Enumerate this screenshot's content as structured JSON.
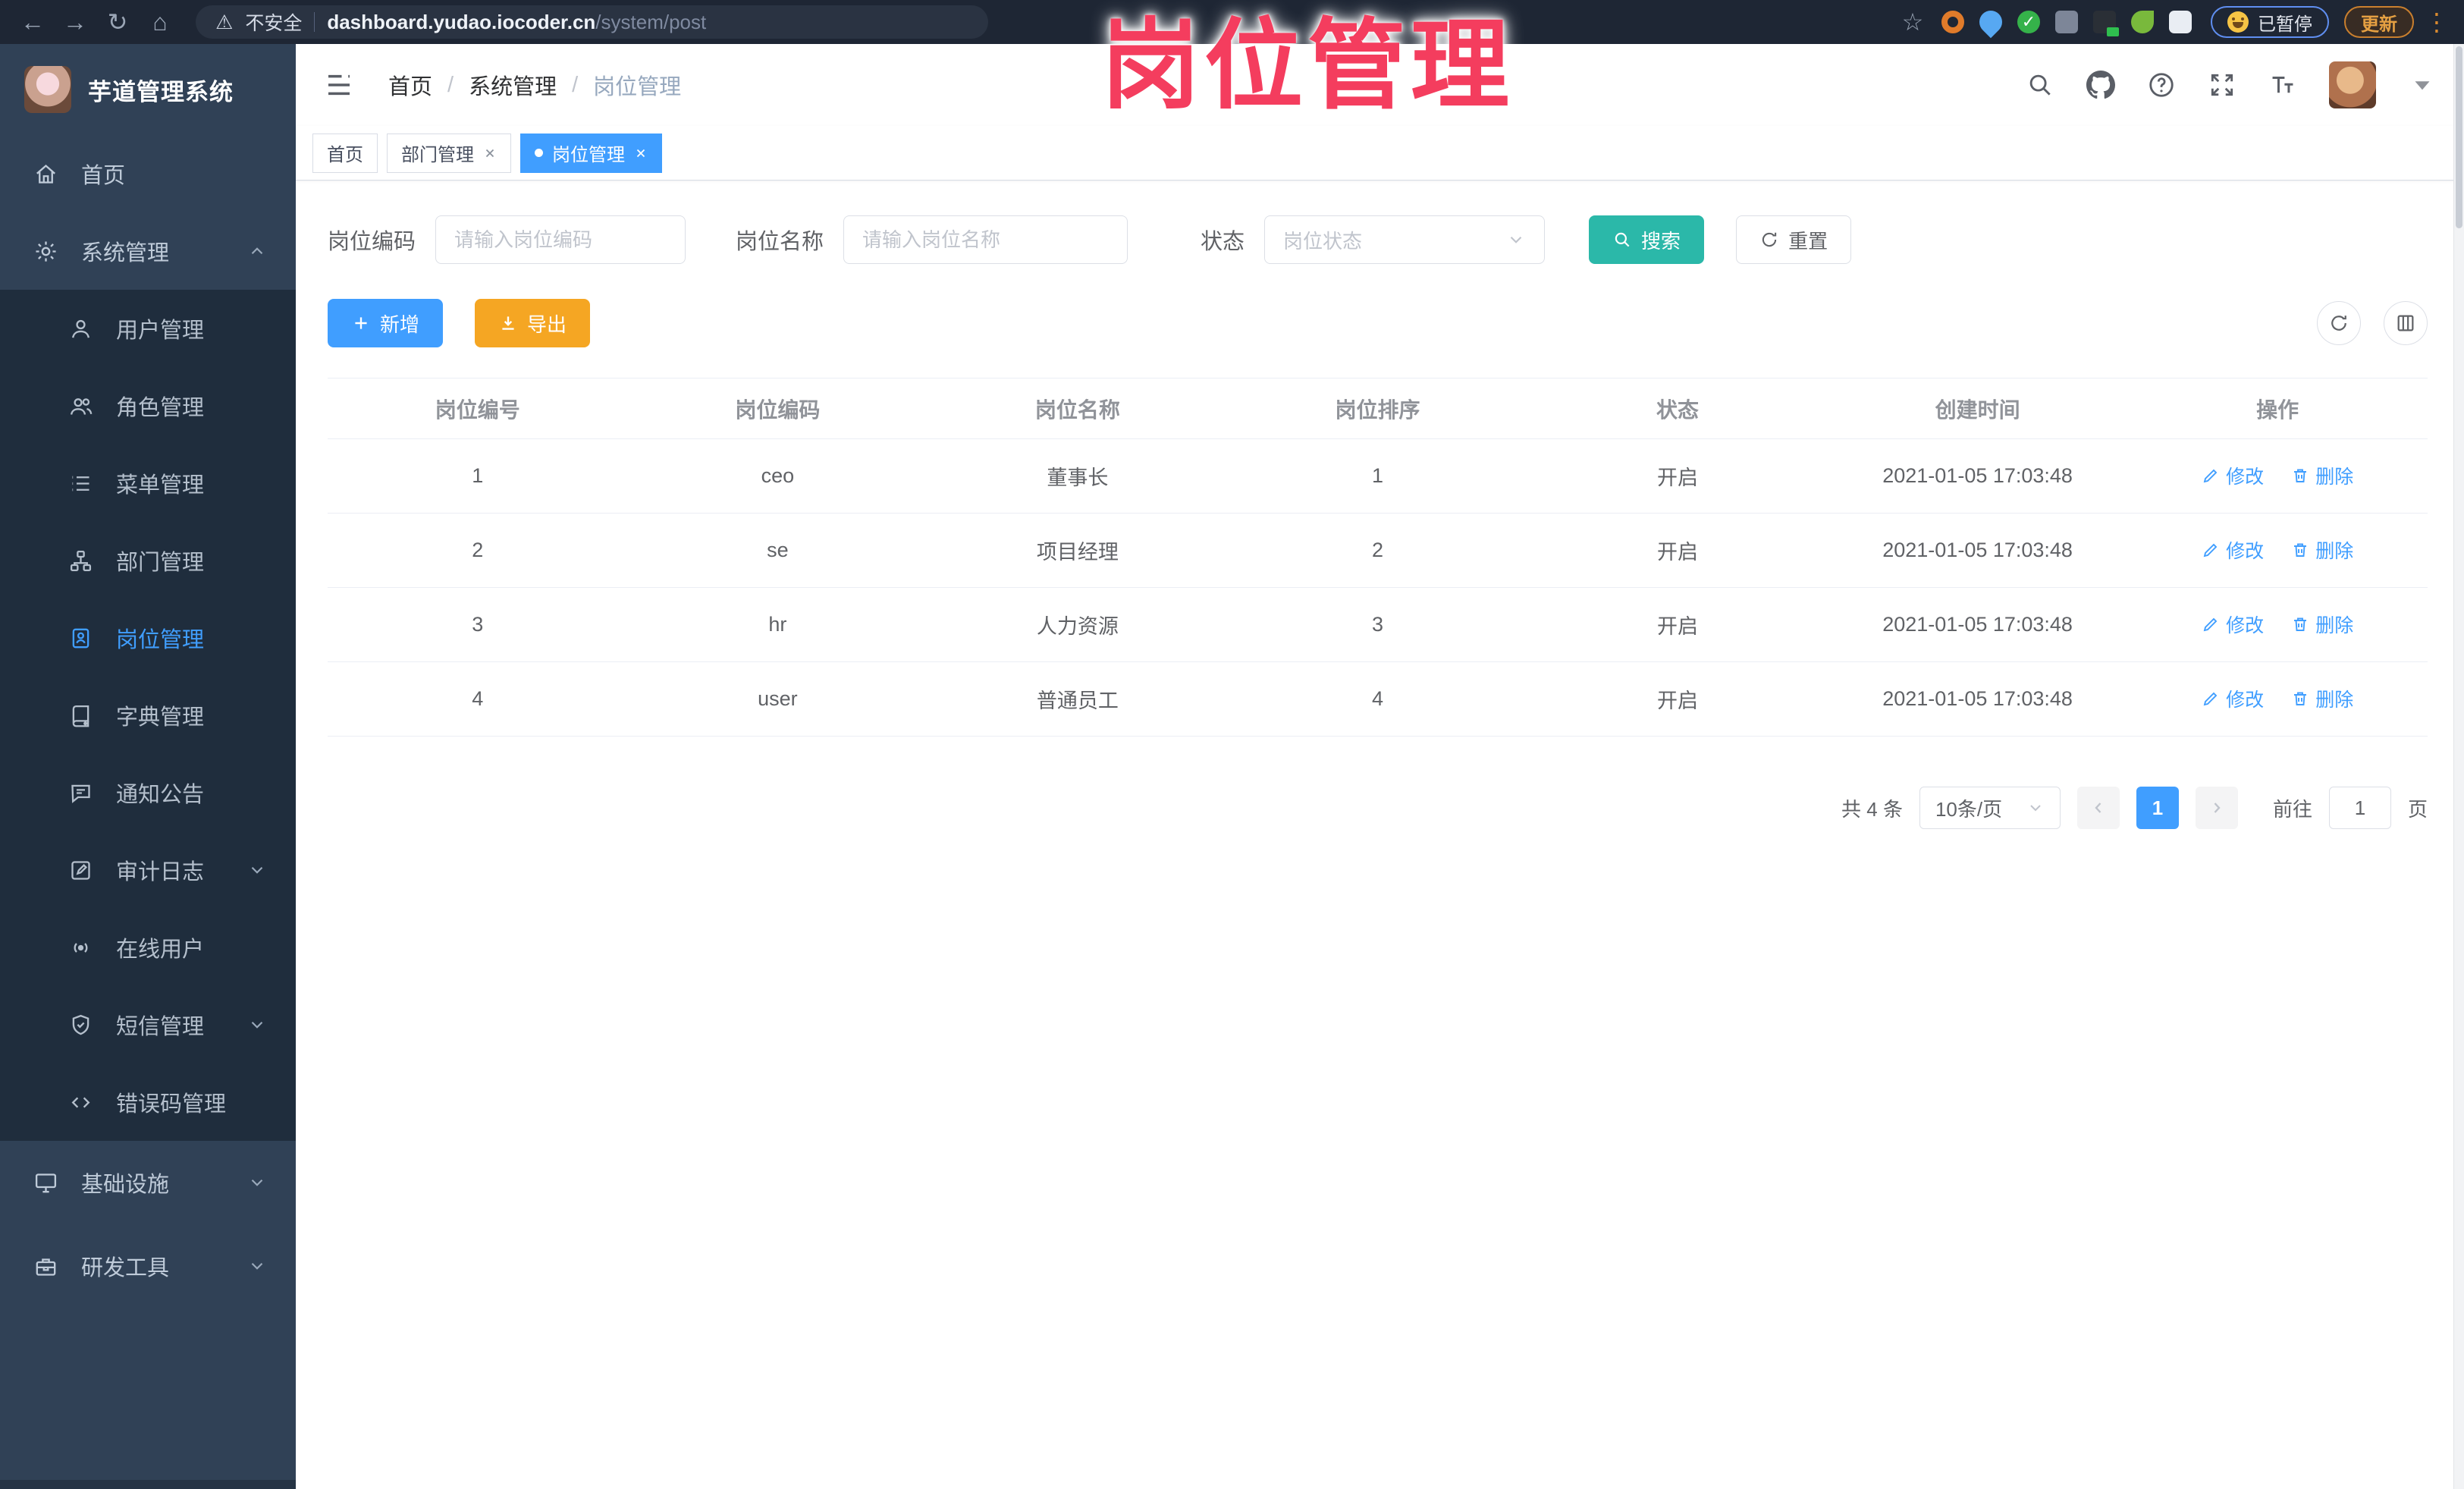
{
  "browser": {
    "back_icon": "←",
    "forward_icon": "→",
    "reload_icon": "↻",
    "home_icon": "⌂",
    "warning_icon": "⚠",
    "security_label": "不安全",
    "url_host": "dashboard.yudao.iocoder.cn",
    "url_path": "/system/post",
    "star_icon": "☆",
    "paused_badge": "已暂停",
    "update_button": "更新",
    "menu_dots_icon": "⋮"
  },
  "annotation": {
    "title": "岗位管理"
  },
  "sidebar": {
    "logo_title": "芋道管理系统",
    "items": [
      {
        "label": "首页"
      },
      {
        "label": "系统管理"
      },
      {
        "label": "用户管理"
      },
      {
        "label": "角色管理"
      },
      {
        "label": "菜单管理"
      },
      {
        "label": "部门管理"
      },
      {
        "label": "岗位管理"
      },
      {
        "label": "字典管理"
      },
      {
        "label": "通知公告"
      },
      {
        "label": "审计日志"
      },
      {
        "label": "在线用户"
      },
      {
        "label": "短信管理"
      },
      {
        "label": "错误码管理"
      },
      {
        "label": "基础设施"
      },
      {
        "label": "研发工具"
      }
    ]
  },
  "breadcrumb": {
    "separator": "/",
    "items": [
      {
        "label": "首页"
      },
      {
        "label": "系统管理"
      },
      {
        "label": "岗位管理"
      }
    ]
  },
  "tabs": [
    {
      "label": "首页"
    },
    {
      "label": "部门管理"
    },
    {
      "label": "岗位管理"
    }
  ],
  "filters": {
    "code_label": "岗位编码",
    "code_placeholder": "请输入岗位编码",
    "name_label": "岗位名称",
    "name_placeholder": "请输入岗位名称",
    "status_label": "状态",
    "status_placeholder": "岗位状态",
    "search_label": "搜索",
    "reset_label": "重置"
  },
  "toolbar": {
    "add_label": "新增",
    "export_label": "导出"
  },
  "table": {
    "headers": [
      "岗位编号",
      "岗位编码",
      "岗位名称",
      "岗位排序",
      "状态",
      "创建时间",
      "操作"
    ],
    "edit_label": "修改",
    "delete_label": "删除",
    "rows": [
      {
        "id": "1",
        "code": "ceo",
        "name": "董事长",
        "sort": "1",
        "status": "开启",
        "created": "2021-01-05 17:03:48"
      },
      {
        "id": "2",
        "code": "se",
        "name": "项目经理",
        "sort": "2",
        "status": "开启",
        "created": "2021-01-05 17:03:48"
      },
      {
        "id": "3",
        "code": "hr",
        "name": "人力资源",
        "sort": "3",
        "status": "开启",
        "created": "2021-01-05 17:03:48"
      },
      {
        "id": "4",
        "code": "user",
        "name": "普通员工",
        "sort": "4",
        "status": "开启",
        "created": "2021-01-05 17:03:48"
      }
    ]
  },
  "pagination": {
    "total": "共 4 条",
    "page_size": "10条/页",
    "current_page": "1",
    "goto_label": "前往",
    "goto_value": "1",
    "page_unit": "页"
  },
  "colors": {
    "primary": "#409EFF",
    "search_teal": "#2BB8A9",
    "export_orange": "#F5A623",
    "annotation_pink": "#F43D5E",
    "sidebar_bg": "#304156",
    "submenu_bg": "#1F2D3D"
  }
}
